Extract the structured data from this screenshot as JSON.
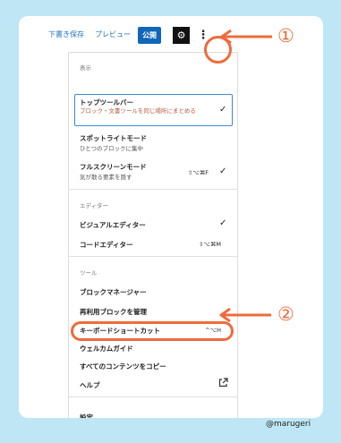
{
  "toolbar": {
    "draft_label": "下書き保存",
    "preview_label": "プレビュー",
    "publish_label": "公開",
    "settings_icon": "gear-icon",
    "more_icon": "vertical-dots-icon"
  },
  "menu": {
    "view_header": "表示",
    "top_toolbar_label": "トップツールバー",
    "top_toolbar_desc": "ブロック・文書ツールを同じ場所にまとめる",
    "top_toolbar_checked": "✓",
    "spotlight_label": "スポットライトモード",
    "spotlight_desc": "ひとつのブロックに集中",
    "fullscreen_label": "フルスクリーンモード",
    "fullscreen_desc": "気が散る要素を隠す",
    "fullscreen_shortcut": "⇧⌥⌘F",
    "fullscreen_checked": "✓",
    "editor_header": "エディター",
    "visual_editor_label": "ビジュアルエディター",
    "visual_editor_checked": "✓",
    "code_editor_label": "コードエディター",
    "code_editor_shortcut": "⇧⌥⌘M",
    "tools_header": "ツール",
    "block_manager_label": "ブロックマネージャー",
    "reusable_blocks_label": "再利用ブロックを管理",
    "keyboard_shortcuts_label": "キーボードショートカット",
    "keyboard_shortcuts_shortcut": "^⌥H",
    "welcome_guide_label": "ウェルカムガイド",
    "copy_all_label": "すべてのコンテンツをコピー",
    "help_label": "ヘルプ",
    "help_icon": "external-link-icon",
    "settings_label": "設定"
  },
  "annotations": {
    "marker1": "①",
    "marker2": "②",
    "accent_color": "#ee6b3d",
    "credit": "@marugeri"
  }
}
